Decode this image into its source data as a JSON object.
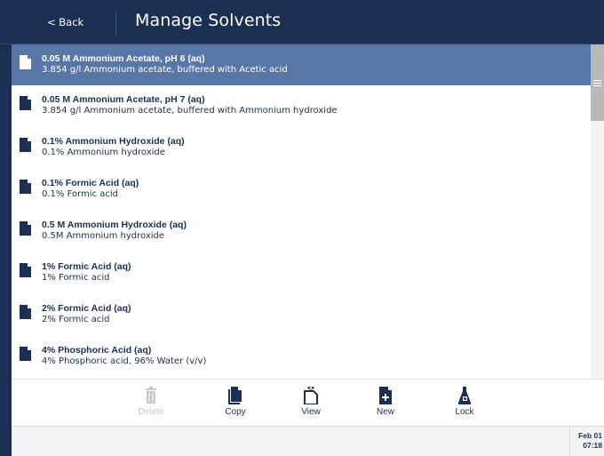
{
  "header": {
    "back_label": "< Back",
    "title": "Manage Solvents"
  },
  "solvents": [
    {
      "title": "0.05 M Ammonium Acetate, pH 6 (aq)",
      "subtitle": "3.854 g/l Ammonium acetate, buffered with Acetic acid",
      "selected": true
    },
    {
      "title": "0.05 M Ammonium Acetate, pH 7 (aq)",
      "subtitle": "3.854 g/l Ammonium acetate, buffered with Ammonium hydroxide",
      "selected": false
    },
    {
      "title": "0.1% Ammonium Hydroxide (aq)",
      "subtitle": "0.1% Ammonium hydroxide",
      "selected": false
    },
    {
      "title": "0.1% Formic Acid (aq)",
      "subtitle": "0.1% Formic acid",
      "selected": false
    },
    {
      "title": "0.5 M Ammonium Hydroxide (aq)",
      "subtitle": "0.5M Ammonium hydroxide",
      "selected": false
    },
    {
      "title": "1% Formic Acid (aq)",
      "subtitle": "1% Formic acid",
      "selected": false
    },
    {
      "title": "2% Formic Acid (aq)",
      "subtitle": "2% Formic acid",
      "selected": false
    },
    {
      "title": "4% Phosphoric Acid (aq)",
      "subtitle": "4% Phosphoric acid, 96% Water (v/v)",
      "selected": false
    }
  ],
  "toolbar": {
    "delete_label": "Delete",
    "copy_label": "Copy",
    "view_label": "View",
    "new_label": "New",
    "lock_label": "Lock"
  },
  "status": {
    "date": "Feb 01",
    "time": "07:18"
  },
  "colors": {
    "navy": "#1b2f52",
    "selected_row": "#5777a7",
    "disabled": "#c4c8cf"
  }
}
